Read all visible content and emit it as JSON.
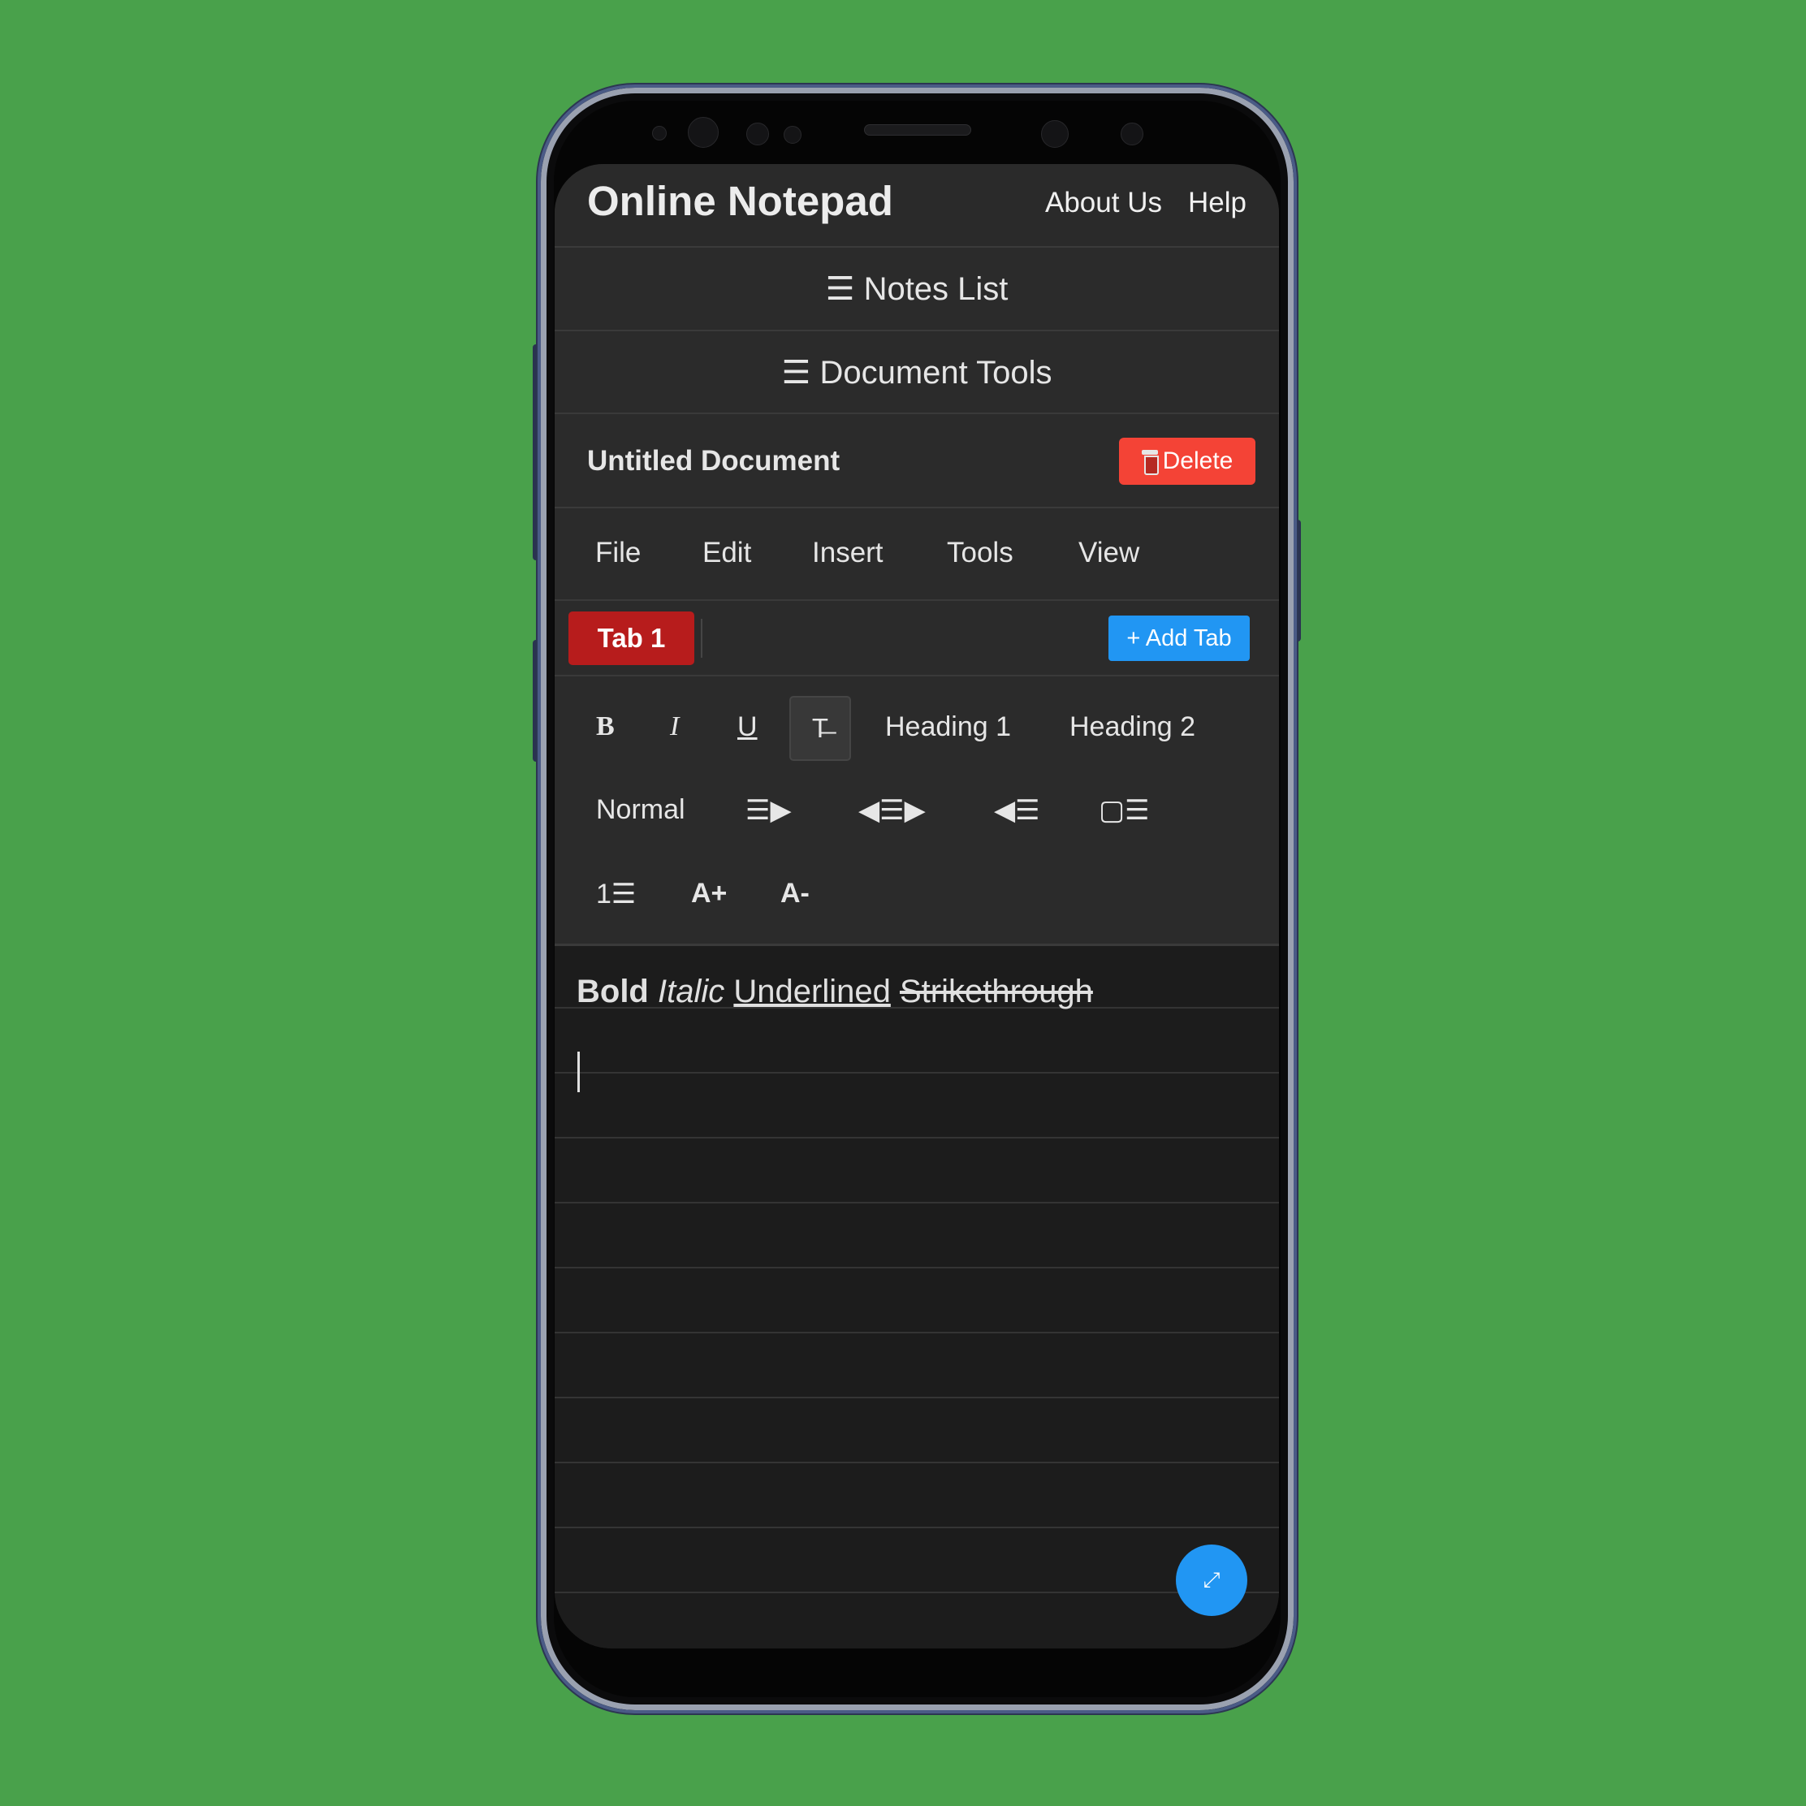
{
  "header": {
    "app_title": "Online Notepad",
    "nav": {
      "about": "About Us",
      "help": "Help"
    }
  },
  "notes_list": {
    "icon": "☰",
    "label": "Notes List"
  },
  "document_tools": {
    "icon": "☰",
    "label": "Document Tools"
  },
  "document": {
    "title": "Untitled Document",
    "delete_label": "Delete",
    "delete_color": "#f44336"
  },
  "menu": [
    "File",
    "Edit",
    "Insert",
    "Tools",
    "View"
  ],
  "tabs": {
    "items": [
      {
        "label": "Tab 1",
        "active": true
      }
    ],
    "add_label": "+ Add Tab",
    "active_color": "#b71c1c",
    "add_color": "#2196f3"
  },
  "toolbar": {
    "bold": "B",
    "italic": "I",
    "underline": "U",
    "strikethrough": "T̶",
    "heading1": "Heading 1",
    "heading2": "Heading 2",
    "normal": "Normal",
    "align_left": "☰▶",
    "align_center": "◀☰▶",
    "align_right": "◀☰",
    "checklist": "▢☰",
    "numbered_list": "1☰",
    "font_increase": "A+",
    "font_decrease": "A-"
  },
  "editor": {
    "bold_text": "Bold",
    "italic_text": "Italic",
    "underlined_text": "Underlined",
    "strikethrough_text": "Strikethrough"
  },
  "fab": {
    "icon": "expand-icon",
    "glyph": "⤢"
  }
}
